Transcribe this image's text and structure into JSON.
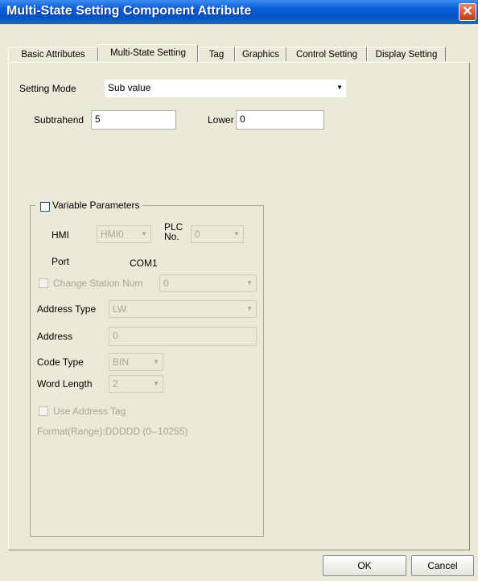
{
  "window": {
    "title": "Multi-State Setting Component Attribute",
    "close_glyph": "✕"
  },
  "tabs": [
    {
      "label": "Basic Attributes"
    },
    {
      "label": "Multi-State Setting"
    },
    {
      "label": "Tag"
    },
    {
      "label": "Graphics"
    },
    {
      "label": "Control Setting"
    },
    {
      "label": "Display Setting"
    }
  ],
  "settings": {
    "mode_label": "Setting Mode",
    "mode_value": "Sub value",
    "subtrahend_label": "Subtrahend",
    "subtrahend_value": "5",
    "lower_label": "Lower",
    "lower_value": "0"
  },
  "variable_params": {
    "checkbox_label": "Variable Parameters",
    "hmi_label": "HMI",
    "hmi_value": "HMI0",
    "plc_no_label_line1": "PLC",
    "plc_no_label_line2": "No.",
    "plc_no_value": "0",
    "port_label": "Port",
    "port_value": "COM1",
    "change_station_label": "Change Station Num",
    "change_station_value": "0",
    "address_type_label": "Address Type",
    "address_type_value": "LW",
    "address_label": "Address",
    "address_value": "0",
    "code_type_label": "Code Type",
    "code_type_value": "BIN",
    "word_length_label": "Word Length",
    "word_length_value": "2",
    "use_address_tag_label": "Use Address Tag",
    "format_text": "Format(Range):DDDDD (0--10255)"
  },
  "footer": {
    "ok_label": "OK",
    "cancel_label": "Cancel"
  },
  "colors": {
    "titlebar": "#0a5fd8",
    "dialog_bg": "#ece9d8",
    "disabled_text": "#a8a49a"
  }
}
